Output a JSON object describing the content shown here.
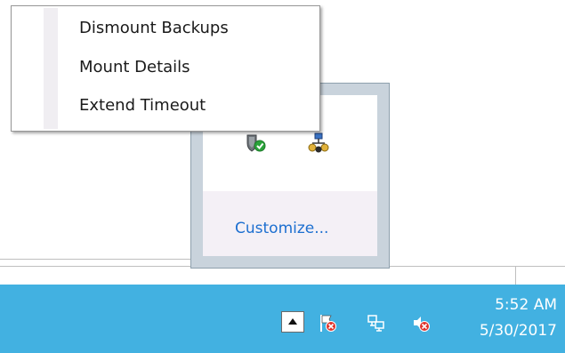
{
  "context_menu": {
    "items": [
      {
        "label": "Dismount Backups"
      },
      {
        "label": "Mount Details"
      },
      {
        "label": "Extend Timeout"
      }
    ]
  },
  "overflow_panel": {
    "icons": [
      "backup-shield-check-icon",
      "network-users-icon"
    ],
    "customize_label": "Customize..."
  },
  "taskbar": {
    "icons": [
      "show-hidden-icons-button",
      "action-center-flag-error-icon",
      "network-icon",
      "volume-muted-icon"
    ],
    "clock": {
      "time": "5:52 AM",
      "date": "5/30/2017"
    },
    "color": "#42b1e1"
  },
  "colors": {
    "link": "#1c6fd0",
    "panel_border": "#c9d3dc"
  }
}
